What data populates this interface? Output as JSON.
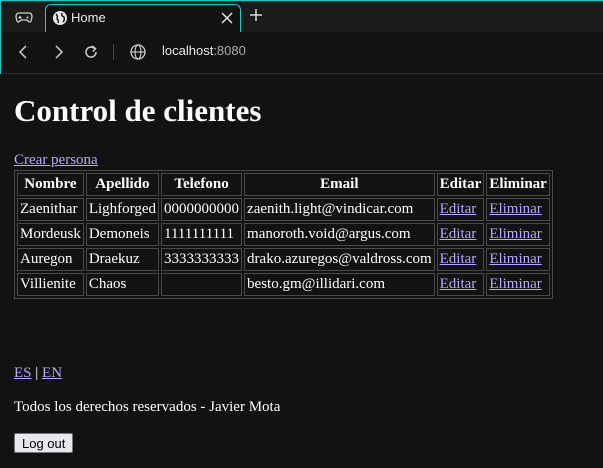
{
  "browser": {
    "tab_title": "Home",
    "url_host": "localhost",
    "url_port": ":8080"
  },
  "page": {
    "heading": "Control de clientes",
    "create_link": "Crear persona",
    "table": {
      "headers": [
        "Nombre",
        "Apellido",
        "Telefono",
        "Email",
        "Editar",
        "Eliminar"
      ],
      "rows": [
        {
          "nombre": "Zaenithar",
          "apellido": "Lighforged",
          "telefono": "0000000000",
          "email": "zaenith.light@vindicar.com",
          "editar": "Editar",
          "eliminar": "Eliminar"
        },
        {
          "nombre": "Mordeusk",
          "apellido": "Demoneis",
          "telefono": "1111111111",
          "email": "manoroth.void@argus.com",
          "editar": "Editar",
          "eliminar": "Eliminar"
        },
        {
          "nombre": "Auregon",
          "apellido": "Draekuz",
          "telefono": "3333333333",
          "email": "drako.azuregos@valdross.com",
          "editar": "Editar",
          "eliminar": "Eliminar"
        },
        {
          "nombre": "Villienite",
          "apellido": "Chaos",
          "telefono": "",
          "email": "besto.gm@illidari.com",
          "editar": "Editar",
          "eliminar": "Eliminar"
        }
      ]
    },
    "lang_es": "ES",
    "lang_sep": " | ",
    "lang_en": "EN",
    "footer": "Todos los derechos reservados - Javier Mota",
    "logout_label": "Log out"
  },
  "icons": {
    "window": "gamepad-icon",
    "tab": "globe-icon",
    "close": "close-icon",
    "new_tab": "plus-icon",
    "back": "arrow-left-icon",
    "forward": "arrow-right-icon",
    "reload": "reload-icon",
    "site_info": "globe-icon"
  },
  "colors": {
    "accent": "#1fc7c2",
    "link": "#b8a8ff",
    "background": "#121212"
  }
}
